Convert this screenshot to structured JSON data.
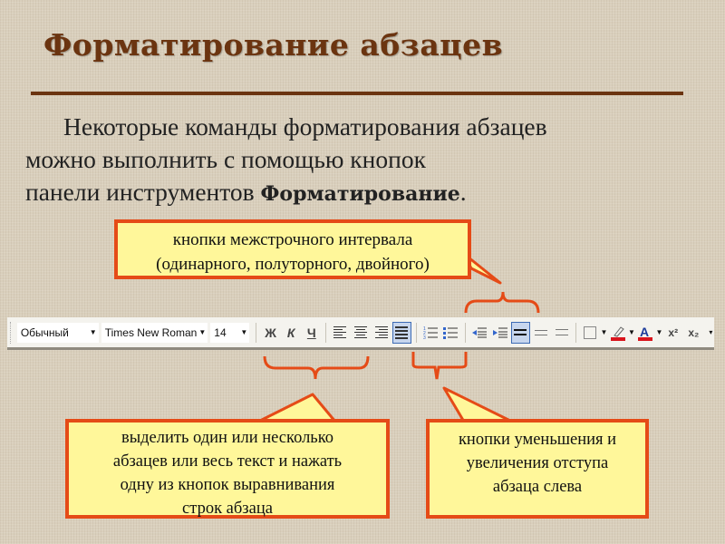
{
  "slide": {
    "title": "Форматирование абзацев",
    "intro": {
      "line1": "Некоторые команды форматирования абзацев",
      "line2": "можно выполнить с помощью кнопок",
      "line3_prefix": "панели инструментов ",
      "line3_bold": "Форматирование",
      "line3_suffix": "."
    }
  },
  "callouts": {
    "line_spacing": {
      "line1": "кнопки межстрочного интервала",
      "line2": "(одинарного, полуторного, двойного)"
    },
    "alignment": {
      "line1": "выделить один или несколько",
      "line2": "абзацев или весь текст и нажать",
      "line3": "одну из кнопок выравнивания",
      "line4": "строк абзаца"
    },
    "indent": {
      "line1": "кнопки уменьшения и",
      "line2": "увеличения отступа",
      "line3": "абзаца слева"
    }
  },
  "toolbar": {
    "style": "Обычный",
    "font": "Times New Roman",
    "size": "14",
    "bold": "Ж",
    "italic": "К",
    "underline": "Ч",
    "superscript": "x²",
    "subscript": "x₂",
    "more": "▾",
    "highlight_color": "#d9141c",
    "font_color": "#d9141c"
  },
  "colors": {
    "title": "#6b3410",
    "callout_fill": "#fff79a",
    "callout_border": "#e54b17"
  }
}
